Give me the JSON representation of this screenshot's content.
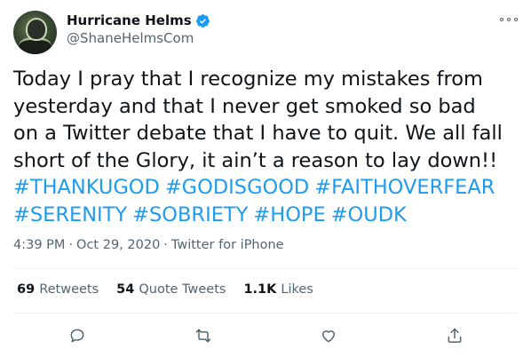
{
  "user": {
    "display_name": "Hurricane Helms",
    "handle": "@ShaneHelmsCom",
    "verified": true
  },
  "tweet": {
    "text": "Today I pray that I recognize my mistakes from\nyesterday and that I never get smoked so bad\non a Twitter debate that I have to quit. We all fall\nshort of the Glory, it ain’t a reason to lay down!!",
    "hashtags": [
      "#THANKUGOD",
      "#GODISGOOD",
      "#FAITHOVERFEAR",
      "#SERENITY",
      "#SOBRIETY",
      "#HOPE",
      "#OUDK"
    ]
  },
  "meta": {
    "time": "4:39 PM",
    "separator": "·",
    "date": "Oct 29, 2020",
    "source": "Twitter for iPhone"
  },
  "stats": {
    "retweets_count": "69",
    "retweets_label": "Retweets",
    "quote_count": "54",
    "quote_label": "Quote Tweets",
    "likes_count": "1.1K",
    "likes_label": "Likes"
  },
  "colors": {
    "accent": "#1d9bf0",
    "text": "#0f1419",
    "secondary": "#536471",
    "divider": "#eff3f4"
  },
  "icons": [
    "verified-badge-icon",
    "more-icon",
    "reply-icon",
    "retweet-icon",
    "like-icon",
    "share-icon"
  ]
}
